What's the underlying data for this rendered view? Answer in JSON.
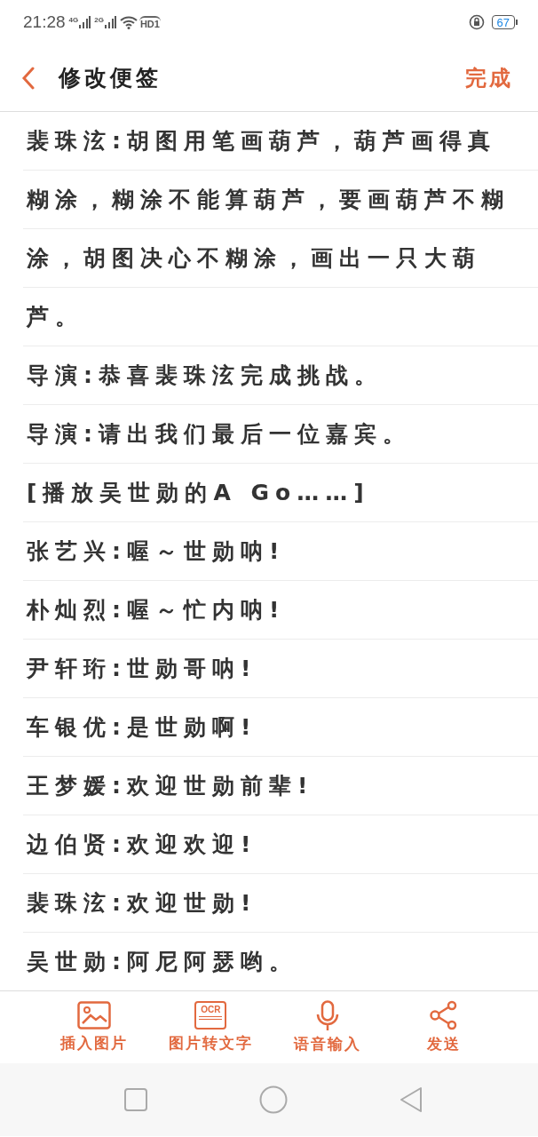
{
  "status_bar": {
    "time": "21:28",
    "signal_labels": [
      "4G",
      "2G"
    ],
    "hd_label": "HD1",
    "battery": "67"
  },
  "header": {
    "title": "修改便签",
    "done": "完成"
  },
  "note": {
    "paragraphs": [
      "裴珠泫:胡图用笔画葫芦，葫芦画得真糊涂，糊涂不能算葫芦，要画葫芦不糊涂，胡图决心不糊涂，画出一只大葫芦。",
      "导演:恭喜裴珠泫完成挑战。",
      "导演:请出我们最后一位嘉宾。",
      "[播放吴世勋的A Go……]",
      "张艺兴:喔～世勋呐!",
      "朴灿烈:喔～忙内呐!",
      "尹轩珩:世勋哥呐!",
      "车银优:是世勋啊!",
      "王梦媛:欢迎世勋前辈!",
      "边伯贤:欢迎欢迎!",
      "裴珠泫:欢迎世勋!",
      "吴世勋:阿尼阿瑟哟。"
    ]
  },
  "toolbar": [
    {
      "kind": "image",
      "label": "插入图片"
    },
    {
      "kind": "ocr",
      "label": "图片转文字",
      "icon_text": "OCR"
    },
    {
      "kind": "mic",
      "label": "语音输入"
    },
    {
      "kind": "share",
      "label": "发送"
    }
  ]
}
